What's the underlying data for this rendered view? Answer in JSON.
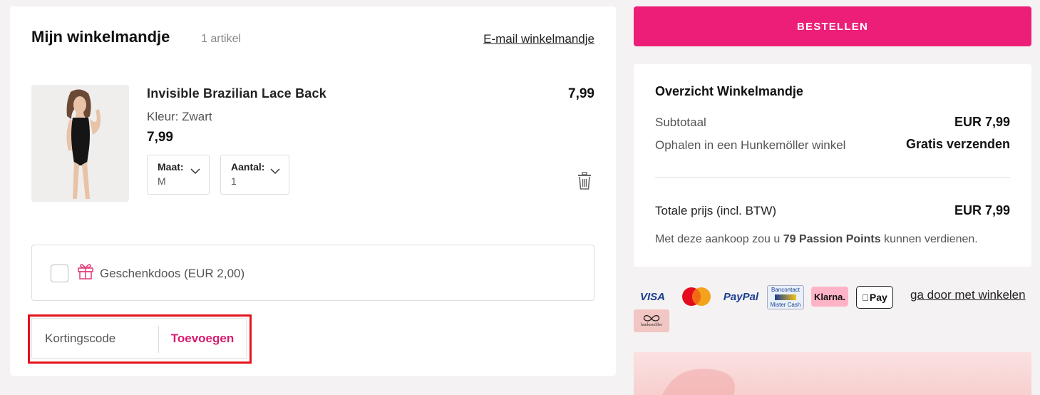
{
  "cart": {
    "title": "Mijn winkelmandje",
    "count": "1 artikel",
    "email_link": "E-mail winkelmandje",
    "item": {
      "name": "Invisible Brazilian Lace Back",
      "color": "Kleur: Zwart",
      "price": "7,99",
      "line_total": "7,99",
      "size_label": "Maat:",
      "size_value": "M",
      "qty_label": "Aantal:",
      "qty_value": "1",
      "image_icon": "product-photo",
      "delete_icon": "trash-icon"
    },
    "gift": {
      "label": "Geschenkdoos (EUR 2,00)",
      "checked": false,
      "icon": "gift-icon"
    },
    "discount": {
      "placeholder": "Kortingscode",
      "button": "Toevoegen"
    }
  },
  "order_button": "BESTELLEN",
  "summary": {
    "title": "Overzicht Winkelmandje",
    "subtotal_label": "Subtotaal",
    "subtotal_value": "EUR 7,99",
    "pickup_label": "Ophalen in een Hunkemöller winkel",
    "pickup_value": "Gratis verzenden",
    "total_label": "Totale prijs (incl. BTW)",
    "total_value": "EUR 7,99",
    "points_prefix": "Met deze aankoop zou u ",
    "points_bold": "79 Passion Points",
    "points_suffix": " kunnen verdienen."
  },
  "payments": {
    "visa": "VISA",
    "paypal": "PayPal",
    "bancontact_top": "Bancontact",
    "bancontact_bottom": "Mister Cash",
    "klarna": "Klarna.",
    "applepay": "Pay",
    "hunkemoller": "hunkemöller"
  },
  "continue_link": "ga door met winkelen",
  "colors": {
    "accent": "#ec1e78",
    "discount_button": "#d81b6f",
    "highlight": "#e4141c",
    "background": "#f4f2f2"
  }
}
